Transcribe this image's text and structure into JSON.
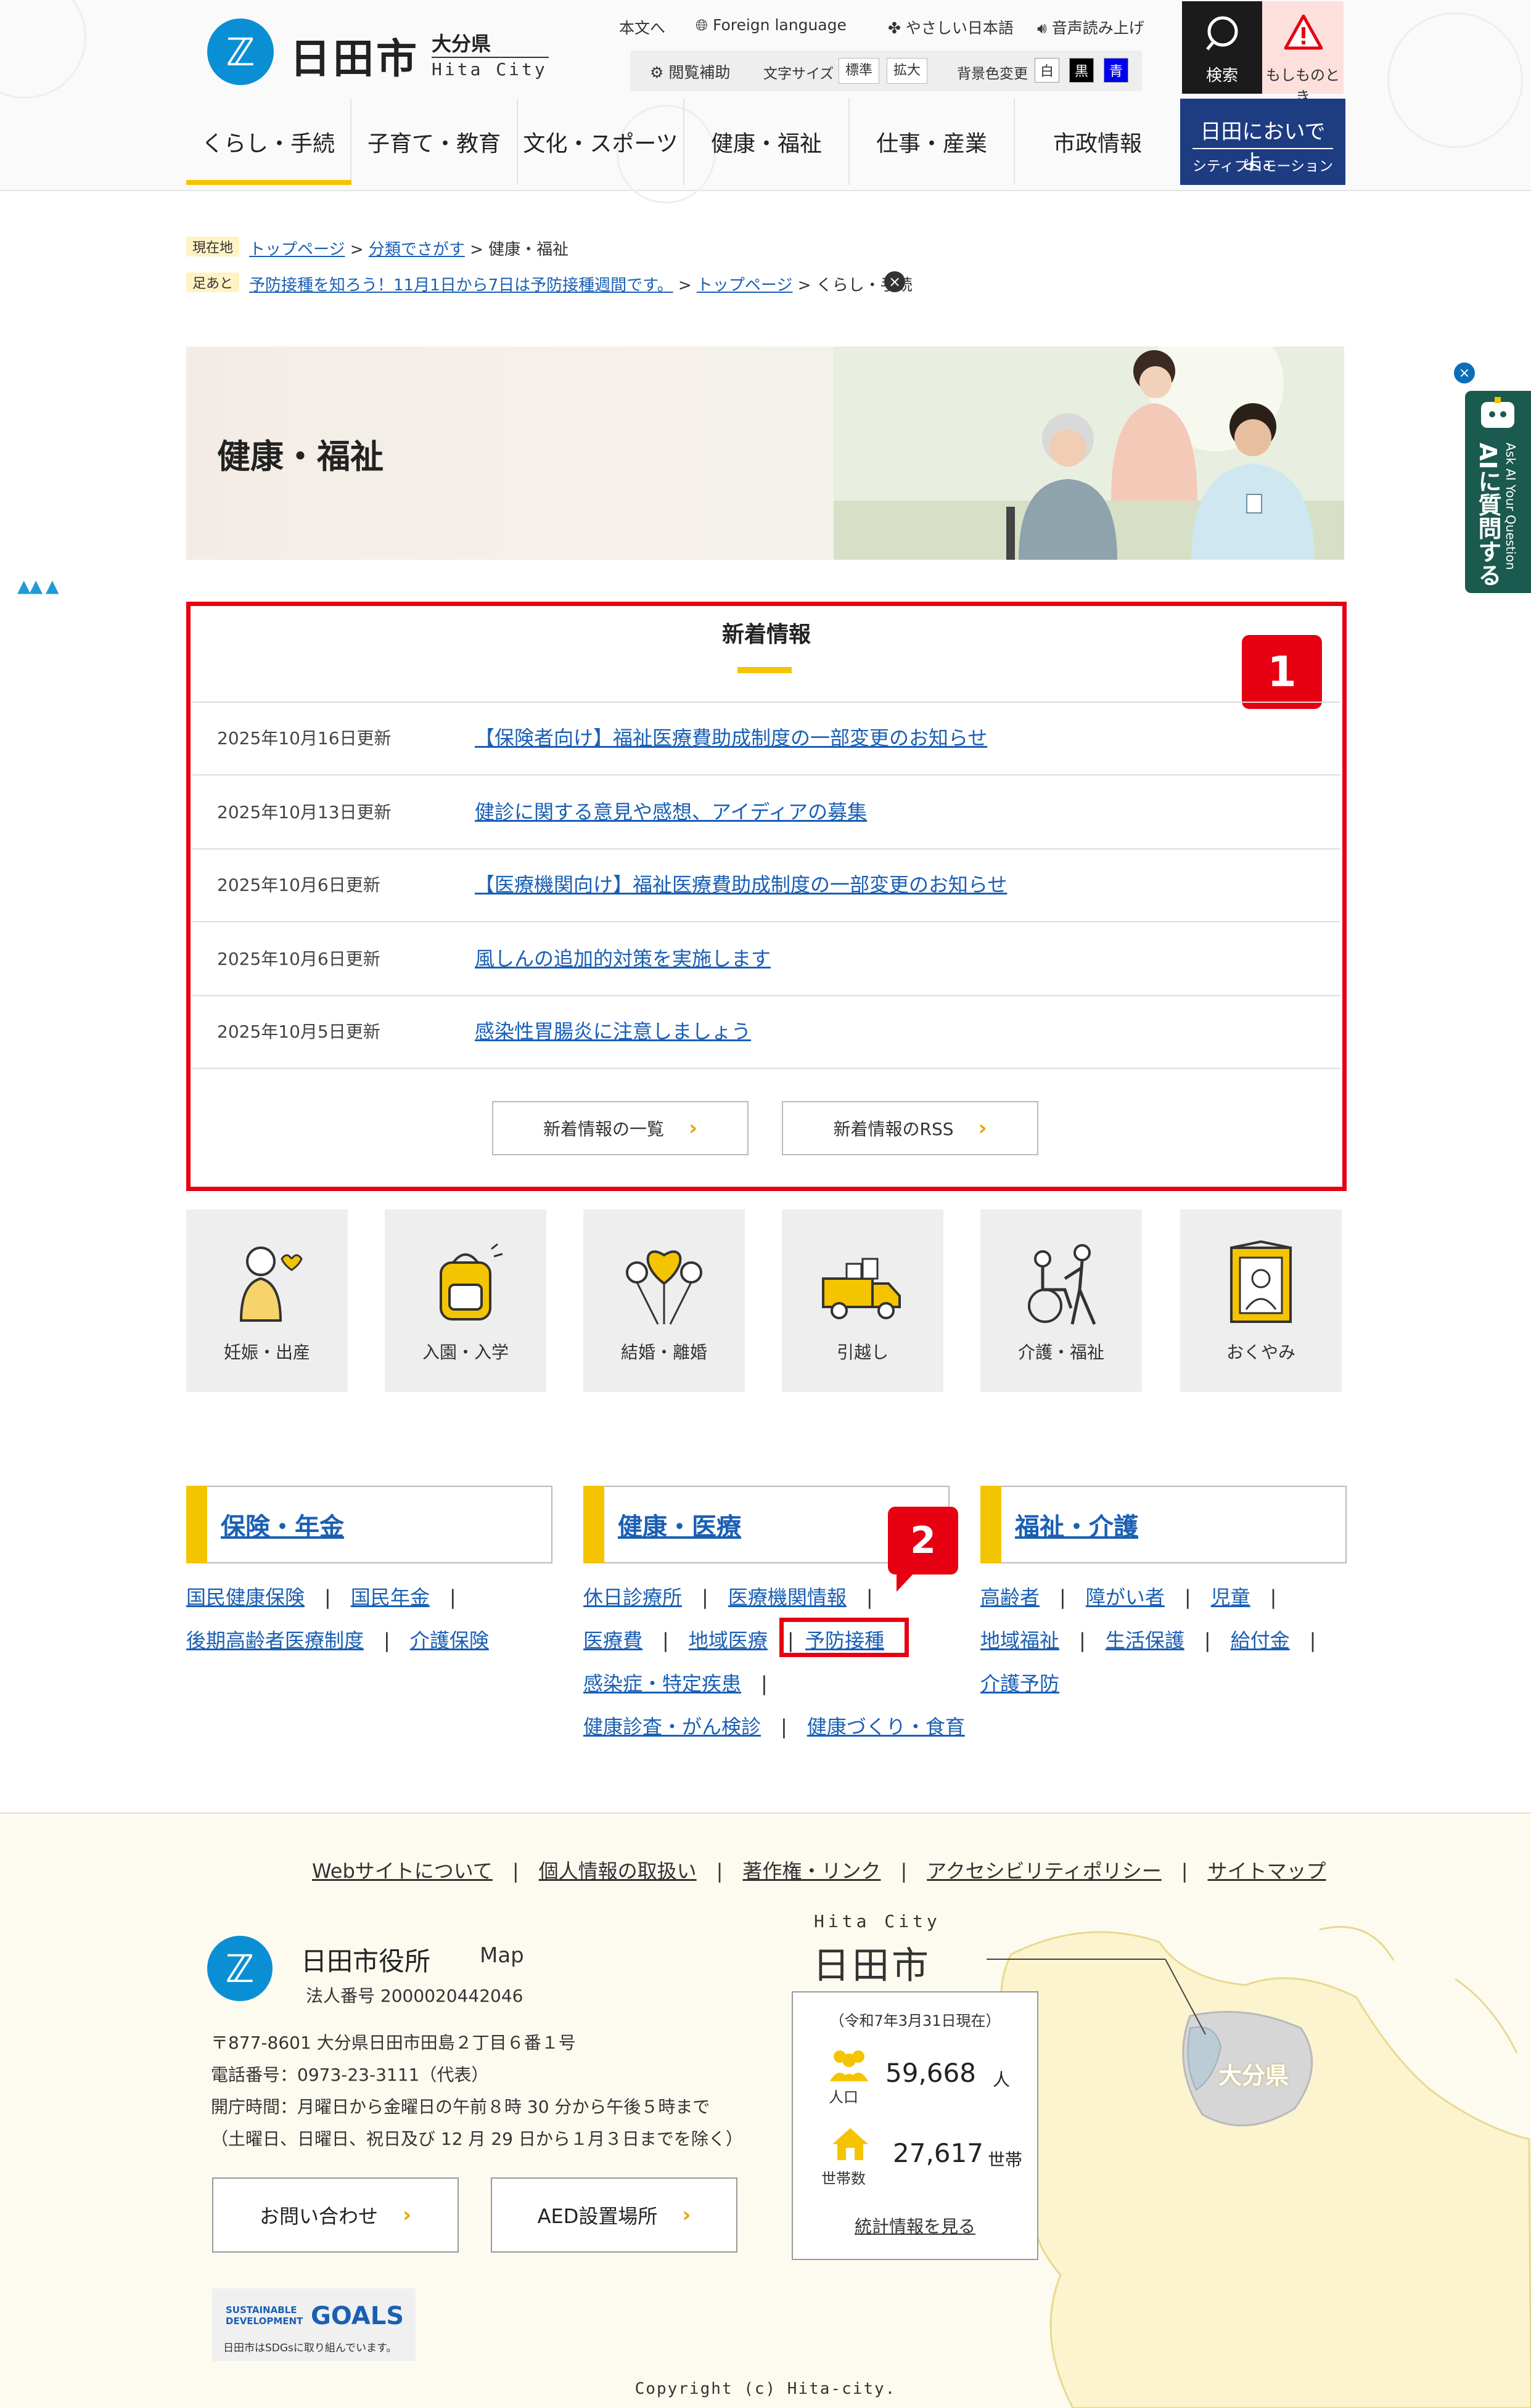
{
  "header": {
    "logo_text": "日田市",
    "logo_mark": "ℤ",
    "pref": "大分県",
    "city_en": "Hita City",
    "util": {
      "skip": "本文へ",
      "foreign": "Foreign language",
      "easy_jp": "やさしい日本語",
      "voice": "音声読み上げ"
    },
    "tools": {
      "assist": "閲覧補助",
      "font_size": "文字サイズ",
      "standard": "標準",
      "enlarge": "拡大",
      "bg_change": "背景色変更",
      "white": "白",
      "black": "黒",
      "blue": "青"
    },
    "search": "検索",
    "emergency": "もしものとき",
    "nav": [
      "くらし・手続",
      "子育て・教育",
      "文化・スポーツ",
      "健康・福祉",
      "仕事・産業",
      "市政情報"
    ],
    "promo_line1": "日田においでよ。",
    "promo_line2": "シティプロモーション"
  },
  "breadcrumb": {
    "current_tag": "現在地",
    "current": [
      "トップページ",
      "分類でさがす",
      "健康・福祉"
    ],
    "history_tag": "足あと",
    "history": [
      "予防接種を知ろう！11月1日から7日は予防接種週間です。",
      "トップページ",
      "くらし・手続"
    ],
    "close": "×"
  },
  "page_title": "健康・福祉",
  "side_ai": {
    "en": "Ask AI Your Question",
    "jp": "AIに質問する",
    "close": "×"
  },
  "news": {
    "heading": "新着情報",
    "items": [
      {
        "date": "2025年10月16日更新",
        "title": "【保険者向け】福祉医療費助成制度の一部変更のお知らせ"
      },
      {
        "date": "2025年10月13日更新",
        "title": "健診に関する意見や感想、アイディアの募集"
      },
      {
        "date": "2025年10月6日更新",
        "title": "【医療機関向け】福祉医療費助成制度の一部変更のお知らせ"
      },
      {
        "date": "2025年10月6日更新",
        "title": "風しんの追加的対策を実施します"
      },
      {
        "date": "2025年10月5日更新",
        "title": "感染性胃腸炎に注意しましょう"
      }
    ],
    "btn_list": "新着情報の一覧",
    "btn_rss": "新着情報のRSS"
  },
  "annotations": {
    "badge1": "1",
    "badge2": "2"
  },
  "tiles": [
    "妊娠・出産",
    "入園・入学",
    "結婚・離婚",
    "引越し",
    "介護・福祉",
    "おくやみ"
  ],
  "categories": {
    "insurance": {
      "title": "保険・年金",
      "links": [
        "国民健康保険",
        "国民年金",
        "後期高齢者医療制度",
        "介護保険"
      ]
    },
    "health": {
      "title": "健康・医療",
      "links": [
        "休日診療所",
        "医療機関情報",
        "医療費",
        "地域医療",
        "予防接種",
        "感染症・特定疾患",
        "健康診査・がん検診",
        "健康づくり・食育"
      ]
    },
    "welfare": {
      "title": "福祉・介護",
      "links": [
        "高齢者",
        "障がい者",
        "児童",
        "地域福祉",
        "生活保護",
        "給付金",
        "介護予防"
      ]
    }
  },
  "footer": {
    "links": [
      "Webサイトについて",
      "個人情報の取扱い",
      "著作権・リンク",
      "アクセシビリティポリシー",
      "サイトマップ"
    ],
    "office": "日田市役所",
    "map": "Map",
    "corp_no": "法人番号 2000020442046",
    "address": "〒877-8601  大分県日田市田島２丁目６番１号",
    "phone": "電話番号：0973-23-3111（代表）",
    "hours": "開庁時間：月曜日から金曜日の午前８時 30 分から午後５時まで",
    "hours_note": "（土曜日、日曜日、祝日及び 12 月 29 日から１月３日までを除く）",
    "btn_contact": "お問い合わせ",
    "btn_aed": "AED設置場所",
    "city_en": "Hita  City",
    "city_jp": "日田市",
    "stats_date": "（令和7年3月31日現在）",
    "population_label": "人口",
    "population": "59,668",
    "population_unit": "人",
    "households_label": "世帯数",
    "households": "27,617",
    "households_unit": "世帯",
    "stats_link": "統計情報を見る",
    "map_label": "大分県",
    "sdgs_line1": "SUSTAINABLE",
    "sdgs_line2": "DEVELOPMENT",
    "sdgs_goals": "GOALS",
    "sdgs_note": "日田市はSDGsに取り組んでいます。",
    "copyright": "Copyright (c) Hita-city."
  },
  "colors": {
    "accent_red": "#e60012",
    "link_blue": "#1a5fb4",
    "yellow": "#f5c400",
    "navy": "#1e3c82",
    "logo_blue": "#0b8fd4"
  }
}
